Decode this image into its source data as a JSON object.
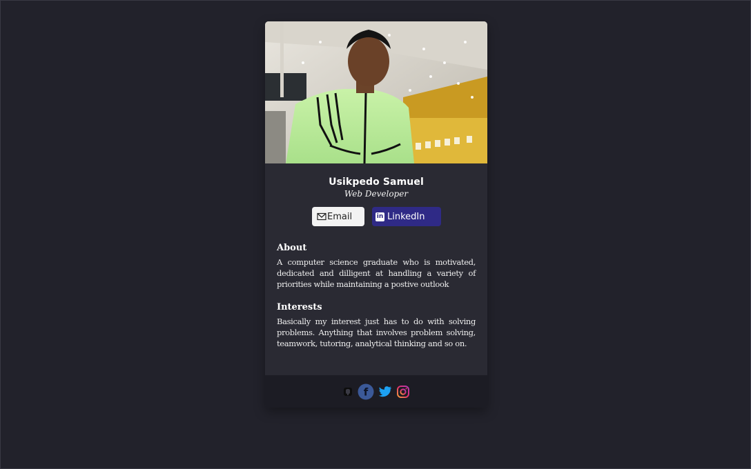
{
  "profile": {
    "name": "Usikpedo Samuel",
    "role": "Web Developer",
    "photo_alt": "profile-photo"
  },
  "buttons": {
    "email_label": "Email",
    "linkedin_label": "LinkedIn",
    "linkedin_badge": "in"
  },
  "about": {
    "heading": "About",
    "text": "A computer science graduate who is motivated, dedicated and dilligent at handling a variety of priorities while maintaining a postive outlook"
  },
  "interests": {
    "heading": "Interests",
    "text": "Basically my interest just has to do with solving problems. Anything that involves problem solving, teamwork, tutoring, analytical thinking and so on."
  },
  "footer": {
    "socials": [
      "github-icon",
      "facebook-icon",
      "twitter-icon",
      "instagram-icon"
    ],
    "facebook_glyph": "f"
  },
  "colors": {
    "background": "#22222b",
    "card": "#2a2a33",
    "footer": "#1c1c24",
    "linkedin": "#2f2a86",
    "email_button": "#f3f3f3",
    "facebook": "#3b5998",
    "twitter": "#1da1f2"
  }
}
